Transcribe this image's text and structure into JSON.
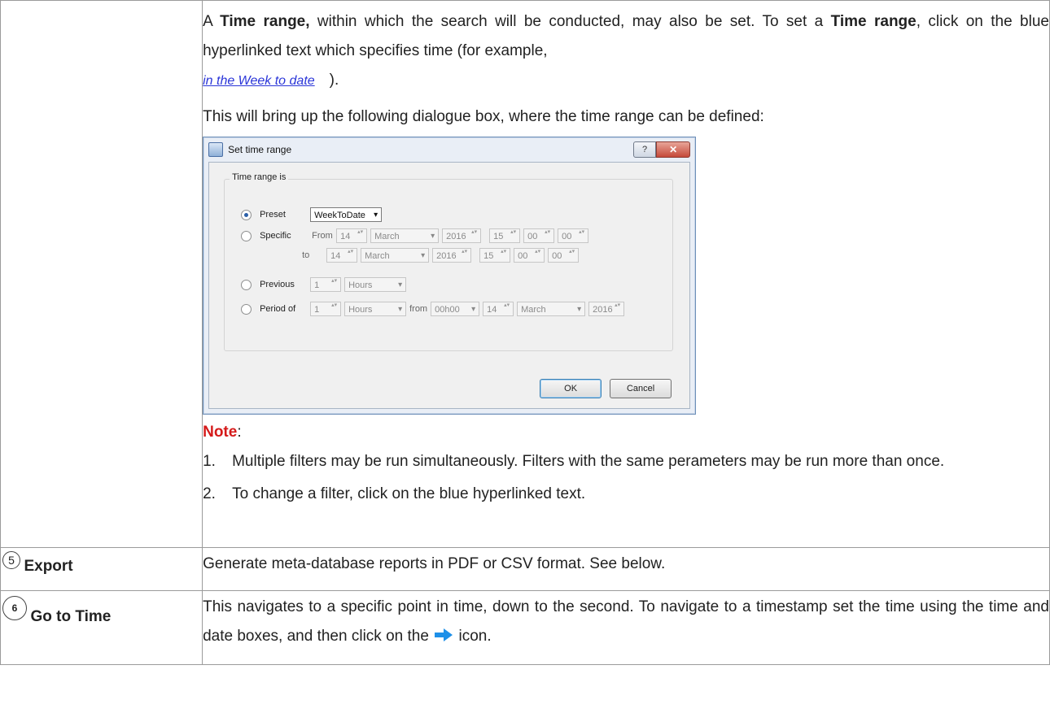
{
  "section": {
    "time_range_para": {
      "t1": "A ",
      "b1": "Time range,",
      "t2": " within which the search will be conducted, may also be set. To set a ",
      "b2": "Time range",
      "t3": ", click on the blue hyperlinked text which specifies time (for example, ",
      "link_example": "in the Week to date",
      "t4": ")."
    },
    "dialogue_intro": "This will bring up the following dialogue box, where the time range can be defined:",
    "note_label": "Note",
    "note_colon": ":",
    "notes": [
      {
        "num": "1.",
        "text": "Multiple filters may be run simultaneously. Filters with the same perameters may be run more than once."
      },
      {
        "num": "2.",
        "text": "To change a filter, click on the blue hyperlinked text."
      }
    ]
  },
  "dialog": {
    "title": "Set time range",
    "help": "?",
    "close": "✕",
    "group_label": "Time range is",
    "preset_label": "Preset",
    "preset_value": "WeekToDate",
    "specific_label": "Specific",
    "from_label": "From",
    "to_label": "to",
    "from": {
      "day": "14",
      "month": "March",
      "year": "2016",
      "h": "15",
      "m": "00",
      "s": "00"
    },
    "to": {
      "day": "14",
      "month": "March",
      "year": "2016",
      "h": "15",
      "m": "00",
      "s": "00"
    },
    "previous_label": "Previous",
    "previous_value": "1",
    "previous_unit": "Hours",
    "period_label": "Period of",
    "period_value": "1",
    "period_unit": "Hours",
    "from_word": "from",
    "period_from": "00h00",
    "period_day": "14",
    "period_month": "March",
    "period_year": "2016",
    "ok": "OK",
    "cancel": "Cancel"
  },
  "rows": [
    {
      "num": "5",
      "label": "Export",
      "text": "Generate meta-database reports in PDF or CSV format. See below."
    },
    {
      "num": "6",
      "label": "Go to Time",
      "text_a": "This navigates to a specific point in time, down to the second. To navigate to a timestamp set the time using the time and date boxes, and then click on the ",
      "text_b": " icon."
    }
  ],
  "colors": {
    "note": "#d51a1a",
    "link": "#2a35d8",
    "arrow": "#1e90e8"
  },
  "icons": {
    "go_arrow": "right-arrow-icon"
  }
}
